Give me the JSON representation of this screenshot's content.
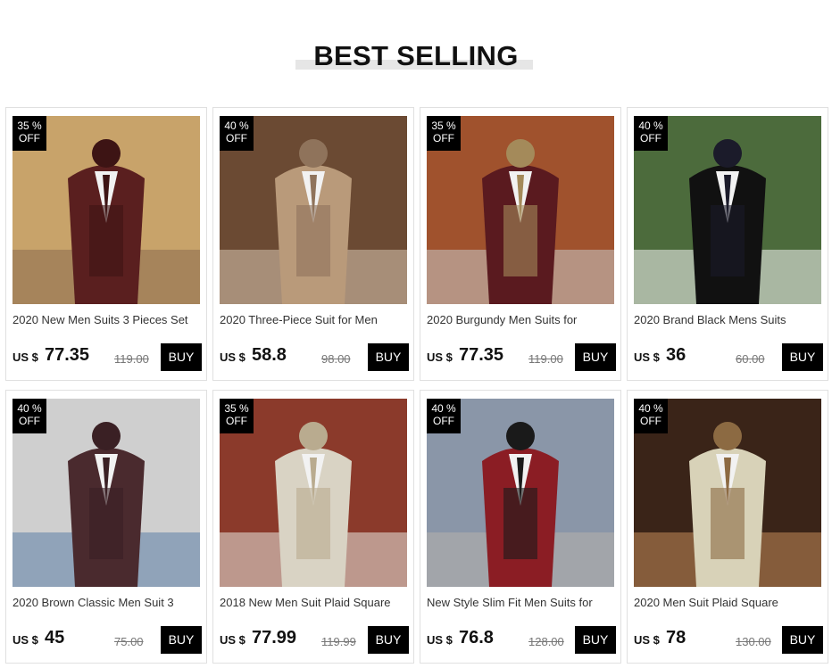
{
  "header": {
    "title": "BEST SELLING"
  },
  "products": [
    {
      "discount_pct": "35 %",
      "discount_off": "OFF",
      "name": "2020 New Men Suits 3 Pieces Set",
      "currency": "US $",
      "price": "77.35",
      "old_price": "119.00",
      "buy": "BUY",
      "palette": [
        "#c8a36a",
        "#5a1f1f",
        "#3d1414",
        "#8a6c4f"
      ]
    },
    {
      "discount_pct": "40 %",
      "discount_off": "OFF",
      "name": "2020 Three-Piece Suit for Men",
      "currency": "US $",
      "price": "58.8",
      "old_price": "98.00",
      "buy": "BUY",
      "palette": [
        "#6b4a33",
        "#b99a7a",
        "#8f735b",
        "#d8c6b0"
      ]
    },
    {
      "discount_pct": "35 %",
      "discount_off": "OFF",
      "name": "2020 Burgundy Men Suits for",
      "currency": "US $",
      "price": "77.35",
      "old_price": "119.00",
      "buy": "BUY",
      "palette": [
        "#a0522d",
        "#5a1a1f",
        "#a48a5a",
        "#c9c9c9"
      ]
    },
    {
      "discount_pct": "40 %",
      "discount_off": "OFF",
      "name": "2020 Brand Black Mens Suits",
      "currency": "US $",
      "price": "36",
      "old_price": "60.00",
      "buy": "BUY",
      "palette": [
        "#4c6b3c",
        "#111111",
        "#1b1b2a",
        "#f5f5f5"
      ]
    },
    {
      "discount_pct": "40 %",
      "discount_off": "OFF",
      "name": "2020 Brown Classic Men Suit 3",
      "currency": "US $",
      "price": "45",
      "old_price": "75.00",
      "buy": "BUY",
      "palette": [
        "#cfcfcf",
        "#4a2a2e",
        "#3a2024",
        "#5d7fa8"
      ]
    },
    {
      "discount_pct": "35 %",
      "discount_off": "OFF",
      "name": "2018 New Men Suit Plaid Square",
      "currency": "US $",
      "price": "77.99",
      "old_price": "119.99",
      "buy": "BUY",
      "palette": [
        "#8b3a2b",
        "#d9d3c4",
        "#b9ab8f",
        "#e8e6df"
      ]
    },
    {
      "discount_pct": "40 %",
      "discount_off": "OFF",
      "name": "New Style Slim Fit Men Suits for",
      "currency": "US $",
      "price": "76.8",
      "old_price": "128.00",
      "buy": "BUY",
      "palette": [
        "#8a96a8",
        "#8b1d24",
        "#1a1a1a",
        "#b7b3ab"
      ]
    },
    {
      "discount_pct": "40 %",
      "discount_off": "OFF",
      "name": "2020 Men Suit Plaid Square",
      "currency": "US $",
      "price": "78",
      "old_price": "130.00",
      "buy": "BUY",
      "palette": [
        "#3a2418",
        "#d8d2b8",
        "#8c6a42",
        "#c28a5a"
      ]
    }
  ]
}
